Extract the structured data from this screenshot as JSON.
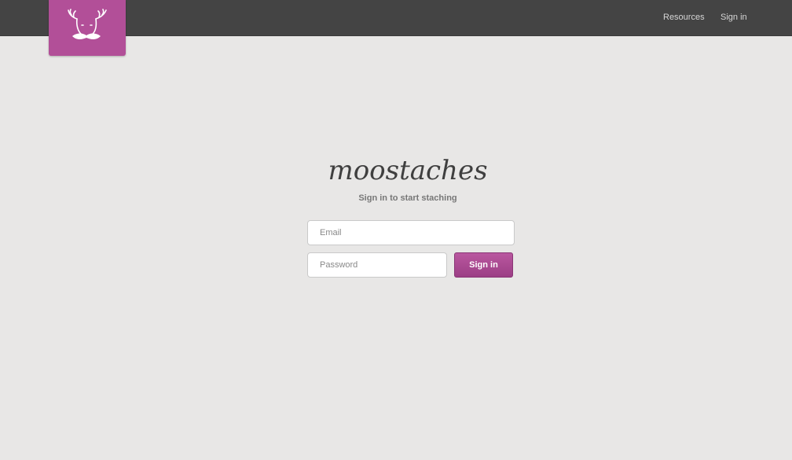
{
  "header": {
    "logo_icon": "moose-mustache-icon",
    "nav": {
      "resources": "Resources",
      "signin": "Sign in"
    }
  },
  "main": {
    "wordmark": "moostaches",
    "tagline": "Sign in to start staching",
    "form": {
      "email_placeholder": "Email",
      "password_placeholder": "Password",
      "submit_label": "Sign in"
    }
  },
  "colors": {
    "brand": "#b24f98",
    "topbar": "#444444",
    "background": "#e8e7e6"
  }
}
